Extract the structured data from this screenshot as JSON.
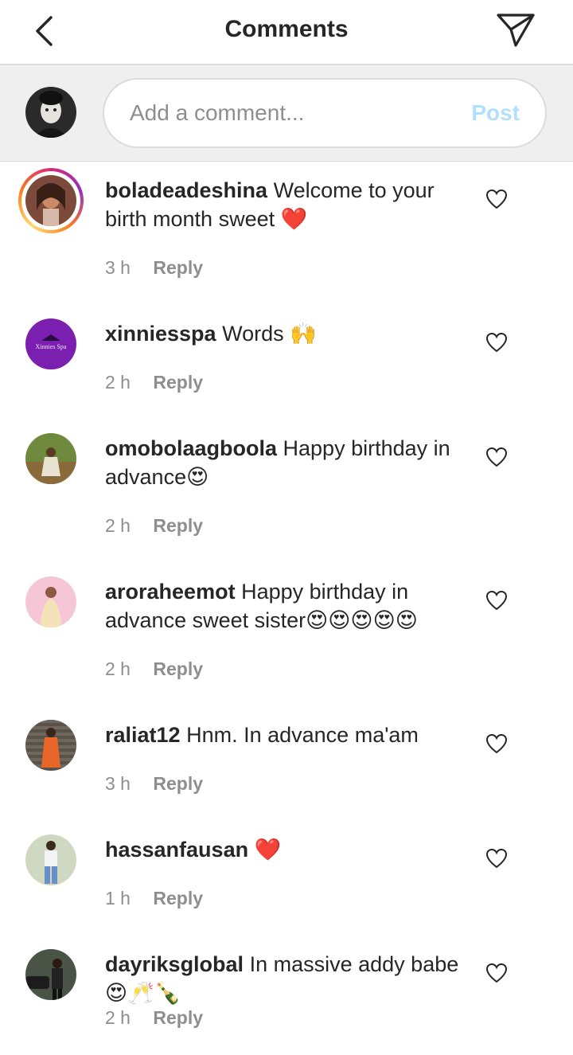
{
  "header": {
    "title": "Comments",
    "back_icon": "chevron-left-icon",
    "send_icon": "paper-plane-icon"
  },
  "composer": {
    "placeholder": "Add a comment...",
    "post_label": "Post"
  },
  "comments": [
    {
      "username": "boladeadeshina",
      "text": "Welcome to your birth month sweet",
      "emoji": "❤️",
      "time": "3 h",
      "reply": "Reply"
    },
    {
      "username": "xinniesspa",
      "text": "Words",
      "emoji": "🙌",
      "time": "2 h",
      "reply": "Reply",
      "avatar_text": "Xinnies Spa"
    },
    {
      "username": "omobolaagboola",
      "text": "Happy birthday in advance",
      "emoji": "😍",
      "time": "2 h",
      "reply": "Reply"
    },
    {
      "username": "aroraheemot",
      "text": "Happy birthday in advance sweet sister",
      "emoji": "😍😍😍😍😍",
      "time": "2 h",
      "reply": "Reply"
    },
    {
      "username": "raliat12",
      "text": "Hnm. In advance ma'am",
      "emoji": "",
      "time": "3 h",
      "reply": "Reply"
    },
    {
      "username": "hassanfausan",
      "text": "",
      "emoji": "❤️",
      "time": "1 h",
      "reply": "Reply"
    },
    {
      "username": "dayriksglobal",
      "text": "In massive addy babe",
      "emoji": "😍🥂🍾",
      "time": "2 h",
      "reply": "Reply"
    }
  ],
  "colors": {
    "link_disabled": "#b2dffc",
    "secondary_text": "#8e8e8e",
    "heart_red": "#e0245e"
  }
}
